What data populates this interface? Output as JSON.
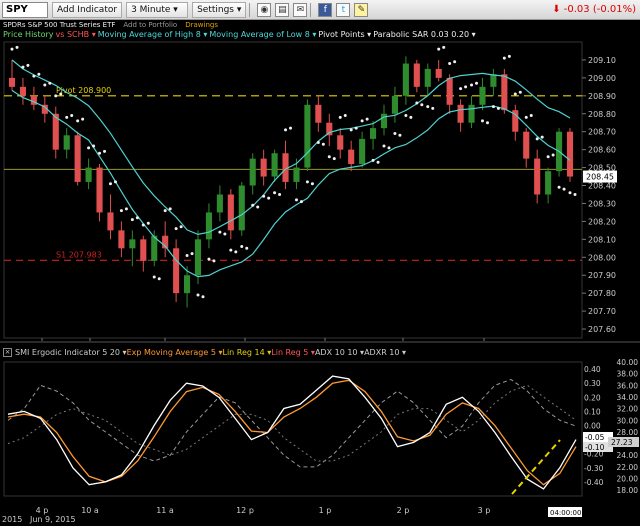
{
  "toolbar": {
    "symbol": "SPY",
    "add_indicator": "Add Indicator",
    "interval": "3 Minute",
    "settings": "Settings",
    "change": "-0.03 (-0.01%)"
  },
  "subheader": {
    "name": "SPDRs S&P 500 Trust Series ETF",
    "add_portfolio": "Add to Portfolio",
    "drawings": "Drawings"
  },
  "legend_top": [
    {
      "text": "Price History",
      "color": "green"
    },
    {
      "text": "vs SCHB ▾",
      "color": "red"
    },
    {
      "text": "Moving Average of High 8 ▾",
      "color": "cyan"
    },
    {
      "text": "Moving Average of Low 8 ▾",
      "color": "cyan"
    },
    {
      "text": "Pivot Points ▾",
      "color": "white"
    },
    {
      "text": "Parabolic SAR 0.03 0.20 ▾",
      "color": "white"
    }
  ],
  "legend_bottom": [
    {
      "text": "SMI Ergodic Indicator 5 20 ▾",
      "color": "gray"
    },
    {
      "text": "Exp Moving Average 5 ▾",
      "color": "orange"
    },
    {
      "text": "Lin Reg 14 ▾",
      "color": "yellow"
    },
    {
      "text": "Lin Reg 5 ▾",
      "color": "red"
    },
    {
      "text": "ADX 10 10 ▾",
      "color": "gray"
    },
    {
      "text": "ADXR 10 ▾",
      "color": "gray"
    }
  ],
  "annotations": {
    "pivot_label": "Pivot 208.900",
    "s1_label": "S1 207.983",
    "price_badge": "208.45",
    "smi_badge_1": "-0.05",
    "smi_badge_2": "-0.10",
    "adx_badge": "27.23",
    "time_badge": "04:00:00",
    "date_label": "Jun 9, 2015",
    "year_label": "2015"
  },
  "colors": {
    "bull": "#2e8b2e",
    "bear": "#e05050",
    "ma": "#4fd0d0",
    "pivot": "#e6d200",
    "s1": "#cc2222",
    "sar": "#f0f0f0",
    "smi": "#ffffff",
    "ema": "#ff9933",
    "adx": "#999999"
  },
  "chart_data": [
    {
      "type": "candlestick",
      "title": "SPY",
      "ylim": [
        207.55,
        209.2
      ],
      "ytick_labels": [
        "209.10",
        "209.00",
        "208.90",
        "208.80",
        "208.70",
        "208.60",
        "208.50",
        "208.40",
        "208.30",
        "208.20",
        "208.10",
        "208.00",
        "207.90",
        "207.80",
        "207.70",
        "207.60"
      ],
      "xtick_labels": [
        "4 p",
        "10 a",
        "11 a",
        "12 p",
        "1 p",
        "2 p",
        "3 p"
      ],
      "pivot": 208.9,
      "s1": 207.983,
      "mid_line": 208.49,
      "last": 208.45,
      "candles": [
        [
          209.0,
          209.1,
          208.93,
          208.95
        ],
        [
          208.95,
          209.0,
          208.85,
          208.9
        ],
        [
          208.9,
          208.95,
          208.82,
          208.85
        ],
        [
          208.85,
          208.9,
          208.75,
          208.8
        ],
        [
          208.8,
          208.84,
          208.55,
          208.6
        ],
        [
          208.6,
          208.72,
          208.55,
          208.68
        ],
        [
          208.68,
          208.7,
          208.4,
          208.42
        ],
        [
          208.42,
          208.55,
          208.38,
          208.5
        ],
        [
          208.5,
          208.52,
          208.2,
          208.25
        ],
        [
          208.25,
          208.35,
          208.1,
          208.15
        ],
        [
          208.15,
          208.2,
          208.0,
          208.05
        ],
        [
          208.05,
          208.15,
          207.95,
          208.1
        ],
        [
          208.1,
          208.12,
          207.92,
          207.98
        ],
        [
          207.98,
          208.15,
          207.95,
          208.12
        ],
        [
          208.12,
          208.2,
          208.0,
          208.05
        ],
        [
          208.05,
          208.1,
          207.75,
          207.8
        ],
        [
          207.8,
          207.95,
          207.72,
          207.9
        ],
        [
          207.9,
          208.15,
          207.85,
          208.1
        ],
        [
          208.1,
          208.3,
          208.05,
          208.25
        ],
        [
          208.25,
          208.4,
          208.2,
          208.35
        ],
        [
          208.35,
          208.38,
          208.1,
          208.15
        ],
        [
          208.15,
          208.42,
          208.12,
          208.4
        ],
        [
          208.4,
          208.58,
          208.35,
          208.55
        ],
        [
          208.55,
          208.6,
          208.4,
          208.45
        ],
        [
          208.45,
          208.6,
          208.42,
          208.58
        ],
        [
          208.58,
          208.65,
          208.38,
          208.42
        ],
        [
          208.42,
          208.55,
          208.38,
          208.5
        ],
        [
          208.5,
          208.88,
          208.48,
          208.85
        ],
        [
          208.85,
          208.9,
          208.7,
          208.75
        ],
        [
          208.75,
          208.8,
          208.62,
          208.68
        ],
        [
          208.68,
          208.72,
          208.55,
          208.6
        ],
        [
          208.6,
          208.65,
          208.48,
          208.52
        ],
        [
          208.52,
          208.7,
          208.5,
          208.66
        ],
        [
          208.66,
          208.76,
          208.6,
          208.72
        ],
        [
          208.72,
          208.85,
          208.68,
          208.8
        ],
        [
          208.8,
          208.95,
          208.75,
          208.9
        ],
        [
          208.9,
          209.12,
          208.85,
          209.08
        ],
        [
          209.08,
          209.1,
          208.92,
          208.95
        ],
        [
          208.95,
          209.08,
          208.9,
          209.05
        ],
        [
          209.05,
          209.1,
          208.98,
          209.0
        ],
        [
          209.0,
          209.02,
          208.8,
          208.85
        ],
        [
          208.85,
          208.88,
          208.7,
          208.75
        ],
        [
          208.75,
          208.9,
          208.72,
          208.85
        ],
        [
          208.85,
          209.0,
          208.82,
          208.95
        ],
        [
          208.95,
          209.05,
          208.9,
          209.02
        ],
        [
          209.02,
          209.05,
          208.8,
          208.82
        ],
        [
          208.82,
          208.85,
          208.65,
          208.7
        ],
        [
          208.7,
          208.72,
          208.5,
          208.55
        ],
        [
          208.55,
          208.6,
          208.3,
          208.35
        ],
        [
          208.35,
          208.5,
          208.3,
          208.48
        ],
        [
          208.48,
          208.72,
          208.45,
          208.7
        ],
        [
          208.7,
          208.72,
          208.42,
          208.45
        ]
      ]
    },
    {
      "type": "line",
      "title": "SMI Ergodic Indicator 5 20",
      "ylim_left": [
        -0.5,
        0.45
      ],
      "ytick_labels_left": [
        "0.40",
        "0.30",
        "0.20",
        "0.10",
        "0.00",
        "-0.10",
        "-0.20",
        "-0.30",
        "-0.40"
      ],
      "ytick_labels_right": [
        "40.00",
        "38.00",
        "36.00",
        "34.00",
        "32.00",
        "30.00",
        "28.00",
        "26.00",
        "24.00",
        "22.00",
        "20.00",
        "18.00"
      ],
      "series": [
        {
          "name": "SMI Ergodic Indicator 5 20",
          "values": [
            0.08,
            0.1,
            0.05,
            -0.1,
            -0.3,
            -0.42,
            -0.4,
            -0.35,
            -0.2,
            0.0,
            0.18,
            0.3,
            0.28,
            0.2,
            0.05,
            -0.1,
            -0.05,
            0.12,
            0.15,
            0.25,
            0.35,
            0.33,
            0.2,
            0.05,
            -0.15,
            -0.12,
            -0.05,
            0.15,
            0.2,
            0.1,
            -0.05,
            -0.22,
            -0.38,
            -0.45,
            -0.3,
            -0.1
          ]
        },
        {
          "name": "Exp Moving Average 5",
          "values": [
            0.06,
            0.08,
            0.06,
            -0.05,
            -0.22,
            -0.36,
            -0.4,
            -0.36,
            -0.25,
            -0.08,
            0.1,
            0.24,
            0.27,
            0.22,
            0.1,
            -0.04,
            -0.05,
            0.06,
            0.12,
            0.2,
            0.3,
            0.32,
            0.24,
            0.1,
            -0.08,
            -0.11,
            -0.07,
            0.08,
            0.16,
            0.12,
            0.0,
            -0.16,
            -0.32,
            -0.42,
            -0.34,
            -0.15
          ]
        },
        {
          "name": "ADX 10 10",
          "values": [
            30,
            32,
            36,
            35,
            33,
            30,
            28,
            26,
            24,
            23,
            24,
            28,
            31,
            34,
            33,
            30,
            27,
            24,
            22,
            22,
            24,
            27,
            30,
            33,
            35,
            33,
            30,
            27,
            29,
            33,
            36,
            37,
            35,
            32,
            30,
            29
          ]
        },
        {
          "name": "ADXR 10",
          "values": [
            26,
            27,
            29,
            31,
            32,
            31,
            30,
            28,
            26,
            25,
            24,
            25,
            27,
            29,
            31,
            31,
            30,
            27,
            25,
            23,
            23,
            24,
            26,
            28,
            31,
            32,
            32,
            30,
            28,
            30,
            33,
            35,
            36,
            34,
            32,
            30
          ]
        }
      ]
    }
  ]
}
